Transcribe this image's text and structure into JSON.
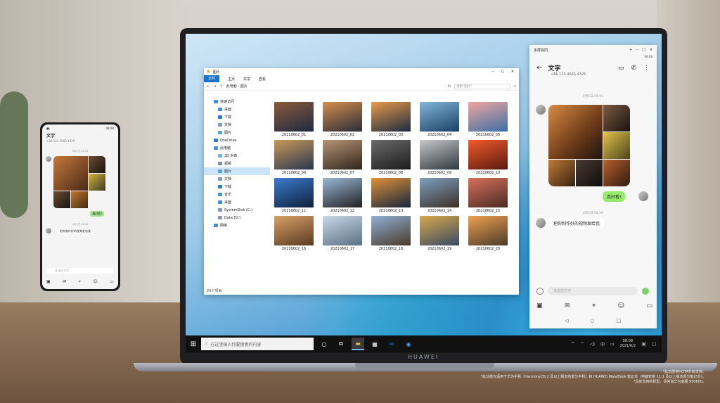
{
  "phone": {
    "status_time": "08:08",
    "contact_name": "文字",
    "contact_number": "+86 123 4565 4325",
    "time1": "4月1日 09:05",
    "bubble_green": "真好看!",
    "time2": "4月2日 08:06",
    "bubble_white": "把你制作好的视频发给我",
    "input_placeholder": "发送短文字"
  },
  "explorer": {
    "title": "图片",
    "ribbon": [
      "文件",
      "主页",
      "共享",
      "查看"
    ],
    "path": "此电脑 › 图片",
    "search_placeholder": "搜索\"图片\"",
    "nav": [
      {
        "label": "快速访问",
        "level": 0,
        "color": "#3c8ee0"
      },
      {
        "label": "桌面",
        "level": 1,
        "color": "#3c8ee0"
      },
      {
        "label": "下载",
        "level": 1,
        "color": "#2a7ad0"
      },
      {
        "label": "文档",
        "level": 1,
        "color": "#7a9bc2"
      },
      {
        "label": "图片",
        "level": 1,
        "color": "#4fa3e0"
      },
      {
        "label": "OneDrive",
        "level": 0,
        "color": "#2f7ed8"
      },
      {
        "label": "此电脑",
        "level": 0,
        "color": "#4a8fd9"
      },
      {
        "label": "3D 对象",
        "level": 1,
        "color": "#66b3e6"
      },
      {
        "label": "视频",
        "level": 1,
        "color": "#7a8db0"
      },
      {
        "label": "图片",
        "level": 1,
        "color": "#4fa3e0",
        "selected": true
      },
      {
        "label": "文档",
        "level": 1,
        "color": "#7a9bc2"
      },
      {
        "label": "下载",
        "level": 1,
        "color": "#2a7ad0"
      },
      {
        "label": "音乐",
        "level": 1,
        "color": "#4a8fd9"
      },
      {
        "label": "桌面",
        "level": 1,
        "color": "#3c8ee0"
      },
      {
        "label": "SystemDisk (C:)",
        "level": 1,
        "color": "#8a99aa"
      },
      {
        "label": "Data (D:)",
        "level": 1,
        "color": "#8a99aa"
      },
      {
        "label": "网络",
        "level": 0,
        "color": "#4a8fd9"
      }
    ],
    "files": [
      {
        "name": "20210602_01",
        "c1": "#8a5a3a",
        "c2": "#1f2a44"
      },
      {
        "name": "20210602_02",
        "c1": "#d4904a",
        "c2": "#2a2a3a"
      },
      {
        "name": "20210602_03",
        "c1": "#e89a4a",
        "c2": "#1c2b40"
      },
      {
        "name": "20210602_04",
        "c1": "#7fb6d8",
        "c2": "#1a4066"
      },
      {
        "name": "20210602_05",
        "c1": "#f1a6a0",
        "c2": "#3b6fa5"
      },
      {
        "name": "20210602_06",
        "c1": "#c89a58",
        "c2": "#2a3550"
      },
      {
        "name": "20210602_07",
        "c1": "#b89576",
        "c2": "#2f241c"
      },
      {
        "name": "20210602_08",
        "c1": "#6a6a6a",
        "c2": "#1c1c1c"
      },
      {
        "name": "20210602_09",
        "c1": "#c7c7c7",
        "c2": "#303840"
      },
      {
        "name": "20210602_10",
        "c1": "#f05a2a",
        "c2": "#5a1a10"
      },
      {
        "name": "20210602_11",
        "c1": "#3c7bd0",
        "c2": "#10203a"
      },
      {
        "name": "20210602_12",
        "c1": "#9ab8d8",
        "c2": "#202020"
      },
      {
        "name": "20210602_13",
        "c1": "#e0923a",
        "c2": "#15253d"
      },
      {
        "name": "20210602_14",
        "c1": "#7e9fc0",
        "c2": "#3b3026"
      },
      {
        "name": "20210602_15",
        "c1": "#d8705a",
        "c2": "#4a2a24"
      },
      {
        "name": "20210602_16",
        "c1": "#d8a068",
        "c2": "#5a3a20"
      },
      {
        "name": "20210602_17",
        "c1": "#c8d8e8",
        "c2": "#5b7084"
      },
      {
        "name": "20210602_18",
        "c1": "#8fb0d8",
        "c2": "#4a3a28"
      },
      {
        "name": "20210602_19",
        "c1": "#d8a84a",
        "c2": "#3a4a66"
      },
      {
        "name": "20210602_20",
        "c1": "#f0a050",
        "c2": "#4a3a2a"
      }
    ],
    "status": "20个项目"
  },
  "chat": {
    "window_title": "多屏协同",
    "status_time": "08:08",
    "contact_name": "文字",
    "contact_number": "+86 123 4565 4325",
    "time1": "4月1日 09:05",
    "bubble_green": "真好看!",
    "time2": "4月2日 08:06",
    "bubble_white": "把你制作好的视频发给我",
    "input_placeholder": "发送短文字"
  },
  "taskbar": {
    "search_placeholder": "在这里输入你要搜索的内容",
    "ime": "中",
    "time": "08:08",
    "date": "2021/6/2"
  },
  "laptop_brand": "HUAWEI",
  "footnote": [
    "*此功能待HOTA升级支持。",
    "*此功能仅适用于华为手机（HarmonyOS 2 及以上版本的部分手机）和 HUAWEI MateBook 笔记本（电脑管家 11.1 及以上版本部分笔记本）。",
    "*具体支持的机型，请咨询华为客服 950800。"
  ]
}
